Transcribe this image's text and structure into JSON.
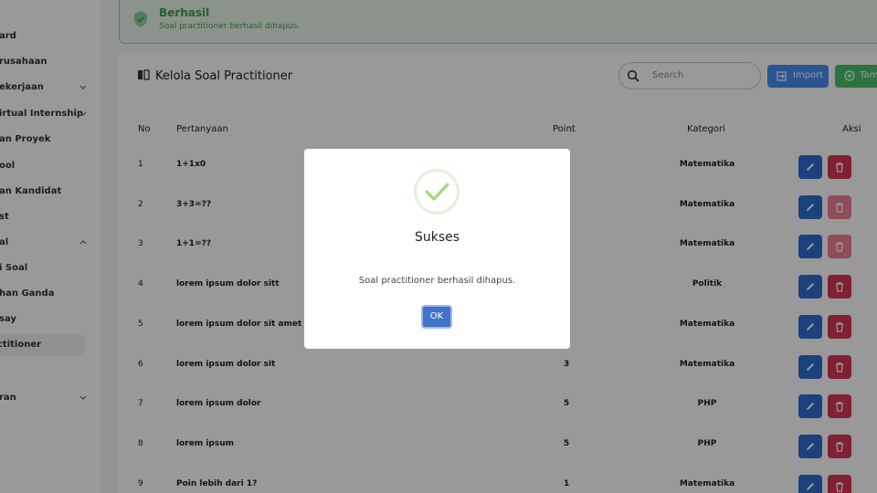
{
  "sidebar": {
    "items": [
      {
        "label": "ard",
        "chevron": ""
      },
      {
        "label": "rusahaan",
        "chevron": ""
      },
      {
        "label": "ekerjaan",
        "chevron": "down"
      },
      {
        "label": "irtual Internship",
        "chevron": "down"
      },
      {
        "label": "an Proyek",
        "chevron": ""
      },
      {
        "label": "ool",
        "chevron": ""
      },
      {
        "label": "an Kandidat",
        "chevron": ""
      },
      {
        "label": "st",
        "chevron": ""
      },
      {
        "label": "al",
        "chevron": "up"
      },
      {
        "label": "i Soal",
        "chevron": ""
      },
      {
        "label": "han Ganda",
        "chevron": ""
      },
      {
        "label": "say",
        "chevron": ""
      },
      {
        "label": "ctitioner",
        "chevron": "",
        "active": true
      },
      {
        "label": "ran",
        "chevron": "down"
      }
    ]
  },
  "alert": {
    "title": "Berhasil",
    "message": "Soal practitioner berhasil dihapus.",
    "icon": "shield-check-icon"
  },
  "card": {
    "title": "Kelola Soal Practitioner",
    "search_placeholder": "Search",
    "import_label": "Import",
    "add_label": "Tambah"
  },
  "table": {
    "headers": {
      "no": "No",
      "question": "Pertanyaan",
      "point": "Point",
      "category": "Kategori",
      "action": "Aksi"
    },
    "rows": [
      {
        "no": "1",
        "question": "1+1x0",
        "point": "",
        "category": "Matematika",
        "delete_disabled": false
      },
      {
        "no": "2",
        "question": "3+3=??",
        "point": "",
        "category": "Matematika",
        "delete_disabled": true
      },
      {
        "no": "3",
        "question": "1+1=??",
        "point": "",
        "category": "Matematika",
        "delete_disabled": true
      },
      {
        "no": "4",
        "question": "lorem ipsum dolor sitt",
        "point": "",
        "category": "Politik",
        "delete_disabled": false
      },
      {
        "no": "5",
        "question": "lorem ipsum dolor sit amet",
        "point": "",
        "category": "Matematika",
        "delete_disabled": false
      },
      {
        "no": "6",
        "question": "lorem ipsum dolor sit",
        "point": "3",
        "category": "Matematika",
        "delete_disabled": false
      },
      {
        "no": "7",
        "question": "lorem ipsum dolor",
        "point": "5",
        "category": "PHP",
        "delete_disabled": false
      },
      {
        "no": "8",
        "question": "lorem ipsum",
        "point": "5",
        "category": "PHP",
        "delete_disabled": false
      },
      {
        "no": "9",
        "question": "Poin lebih dari 1?",
        "point": "1",
        "category": "Matematika",
        "delete_disabled": false
      }
    ]
  },
  "modal": {
    "title": "Sukses",
    "message": "Soal practitioner berhasil dihapus.",
    "ok_label": "OK",
    "icon": "checkmark-icon"
  },
  "colors": {
    "primary": "#4a8ef0",
    "success": "#4cc06a",
    "danger": "#d63a55",
    "edit": "#2d6fd1",
    "ok_button": "#4173c8",
    "alert_text": "#3aa14a"
  }
}
